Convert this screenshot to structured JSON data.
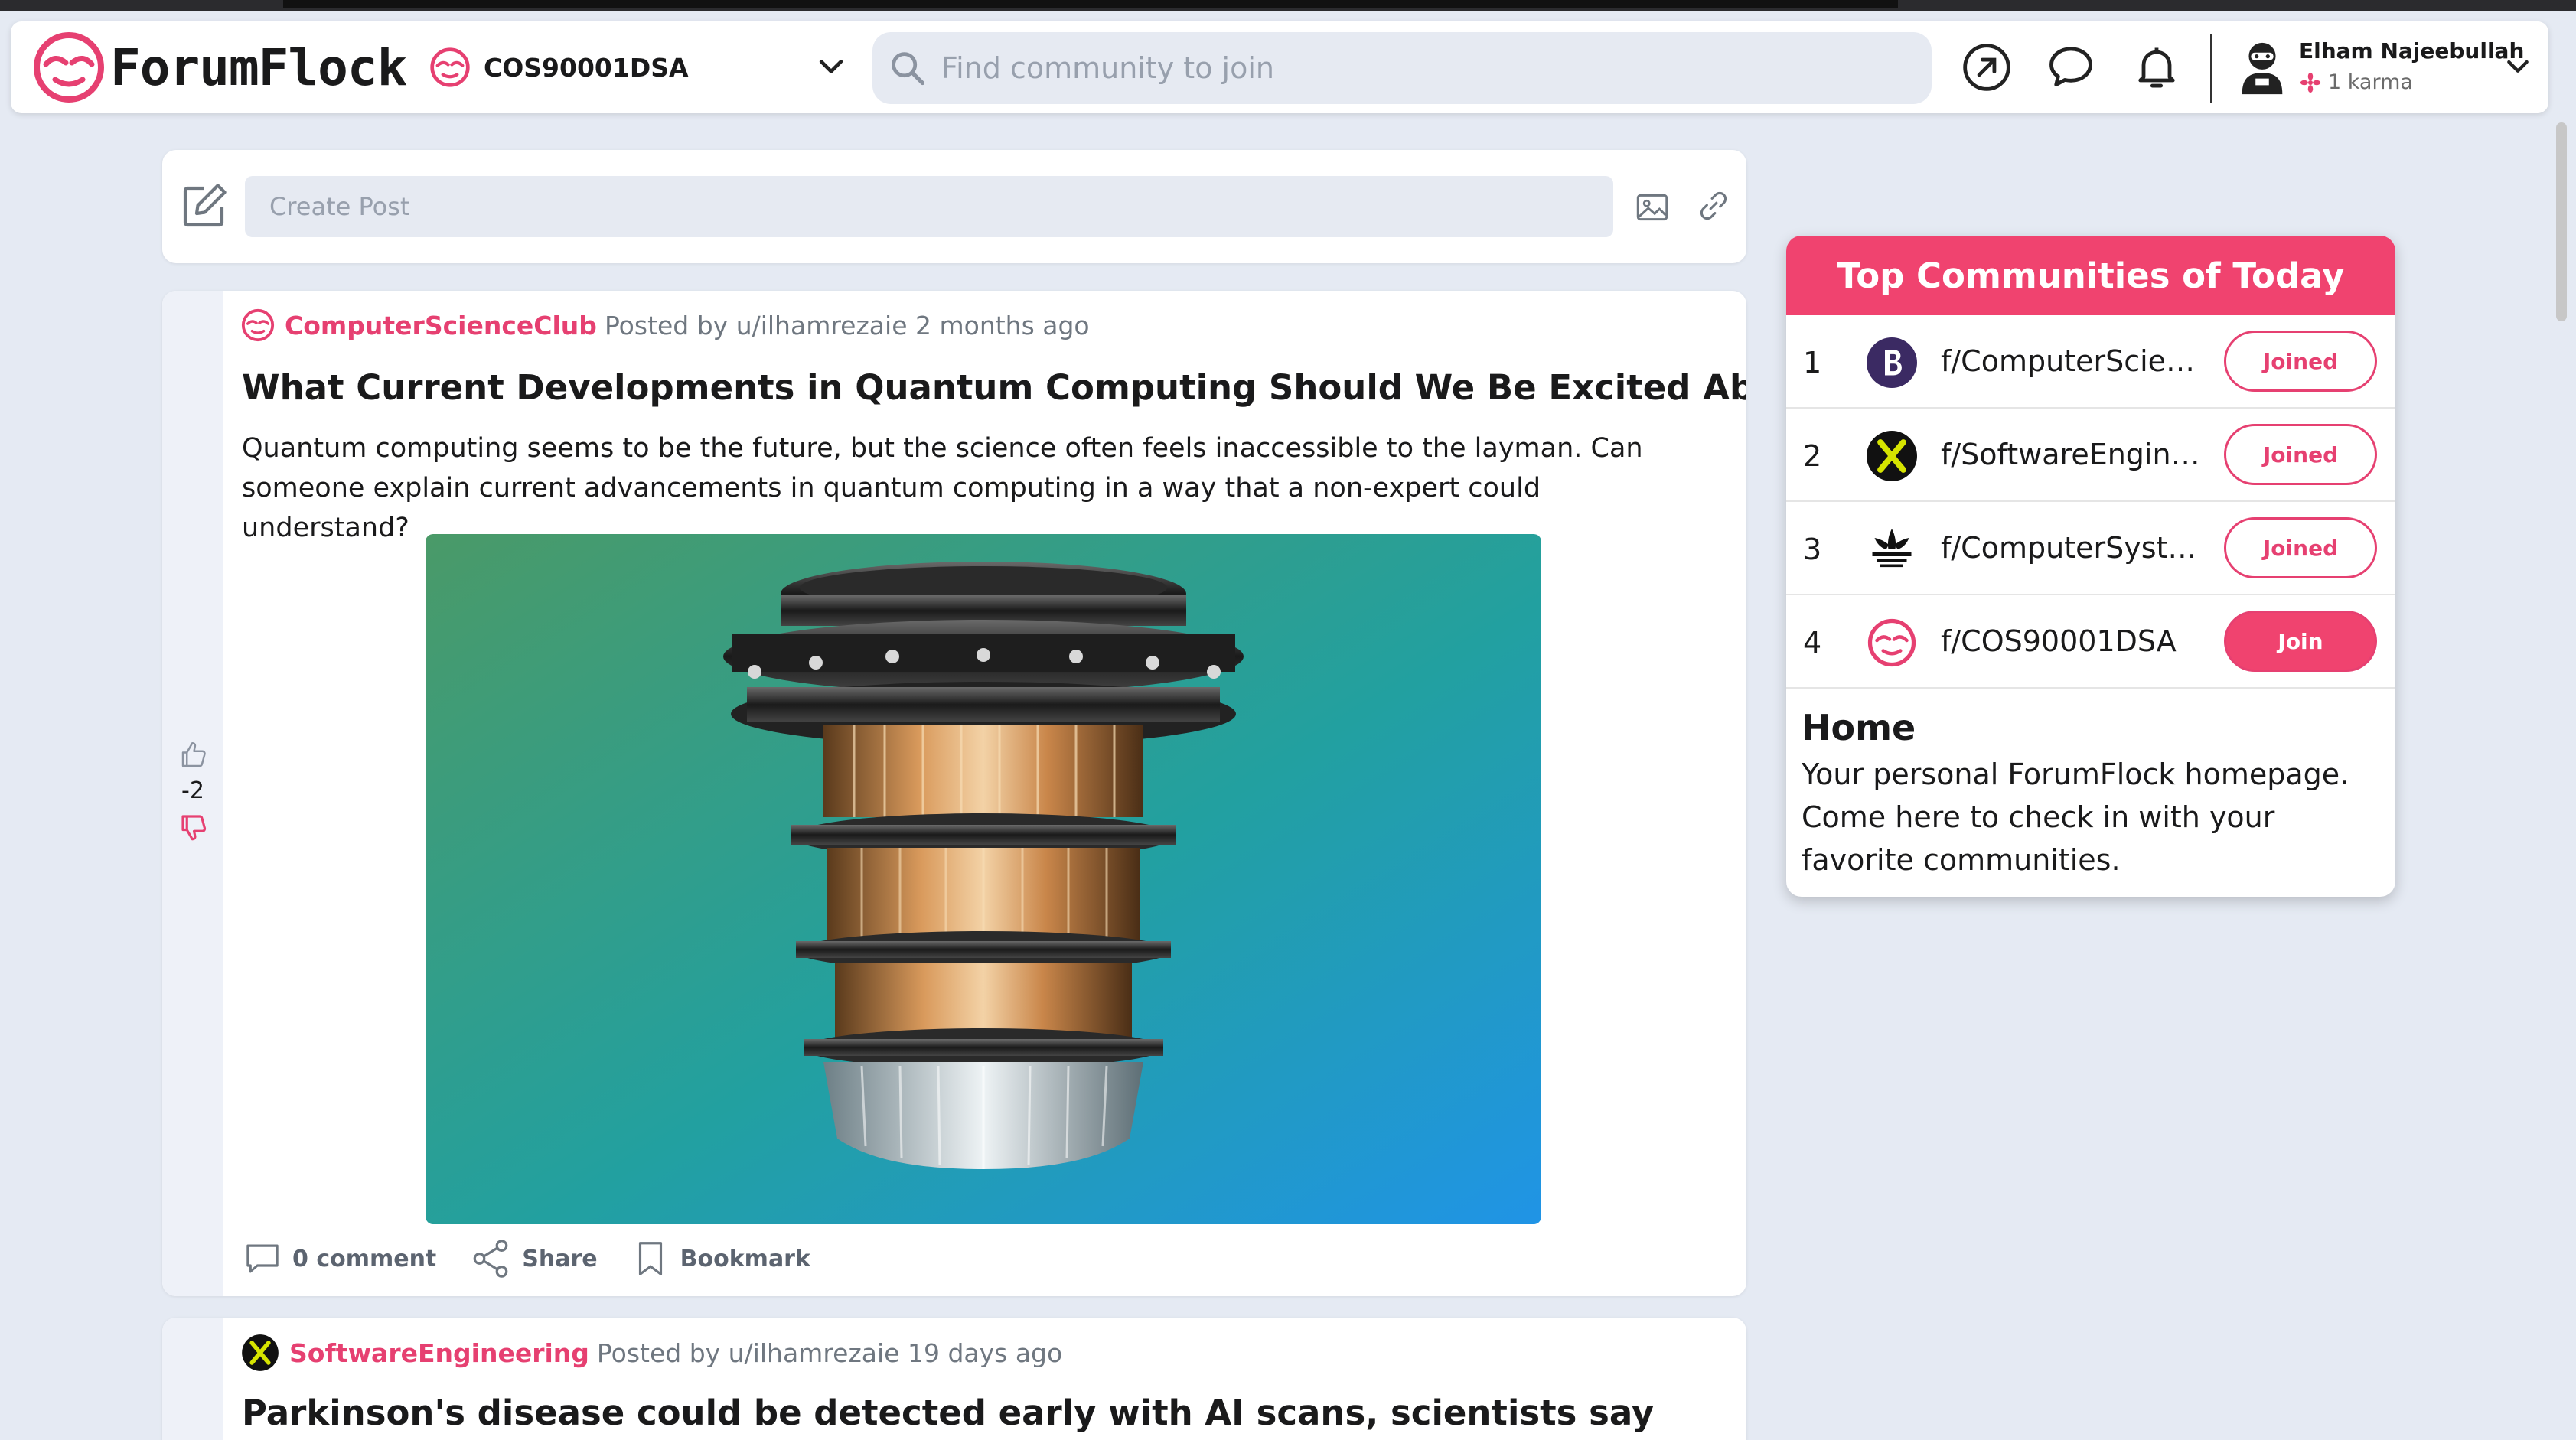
{
  "app": {
    "brand": "ForumFlock",
    "accent": "#e64071"
  },
  "header": {
    "community_selector": "COS90001DSA",
    "search_placeholder": "Find community to join",
    "icons": [
      "popular-icon",
      "chat-icon",
      "notification-bell-icon"
    ],
    "user": {
      "name": "Elham Najeebullah",
      "karma": "1 karma"
    }
  },
  "create_post": {
    "placeholder": "Create Post"
  },
  "posts": [
    {
      "community": "ComputerScienceClub",
      "posted_by": "Posted by u/ilhamrezaie 2 months ago",
      "title": "What Current Developments in Quantum Computing Should We Be Excited About?",
      "body": "Quantum computing seems to be the future, but the science often feels inaccessible to the layman. Can someone explain current advancements in quantum computing in a way that a non-expert could understand?",
      "votes": "-2",
      "actions": {
        "comments": "0 comment",
        "share": "Share",
        "bookmark": "Bookmark"
      }
    },
    {
      "community": "SoftwareEngineering",
      "posted_by": "Posted by u/ilhamrezaie 19 days ago",
      "title": "Parkinson's disease could be detected early with AI scans, scientists say"
    }
  ],
  "sidebar": {
    "title": "Top Communities of Today",
    "communities": [
      {
        "rank": "1",
        "name": "f/ComputerScienceClub",
        "button": "Joined"
      },
      {
        "rank": "2",
        "name": "f/SoftwareEngineering",
        "button": "Joined"
      },
      {
        "rank": "3",
        "name": "f/ComputerSystems",
        "button": "Joined"
      },
      {
        "rank": "4",
        "name": "f/COS90001DSA",
        "button": "Join"
      }
    ],
    "home": {
      "title": "Home",
      "description": "Your personal ForumFlock homepage. Come here to check in with your favorite communities."
    }
  }
}
